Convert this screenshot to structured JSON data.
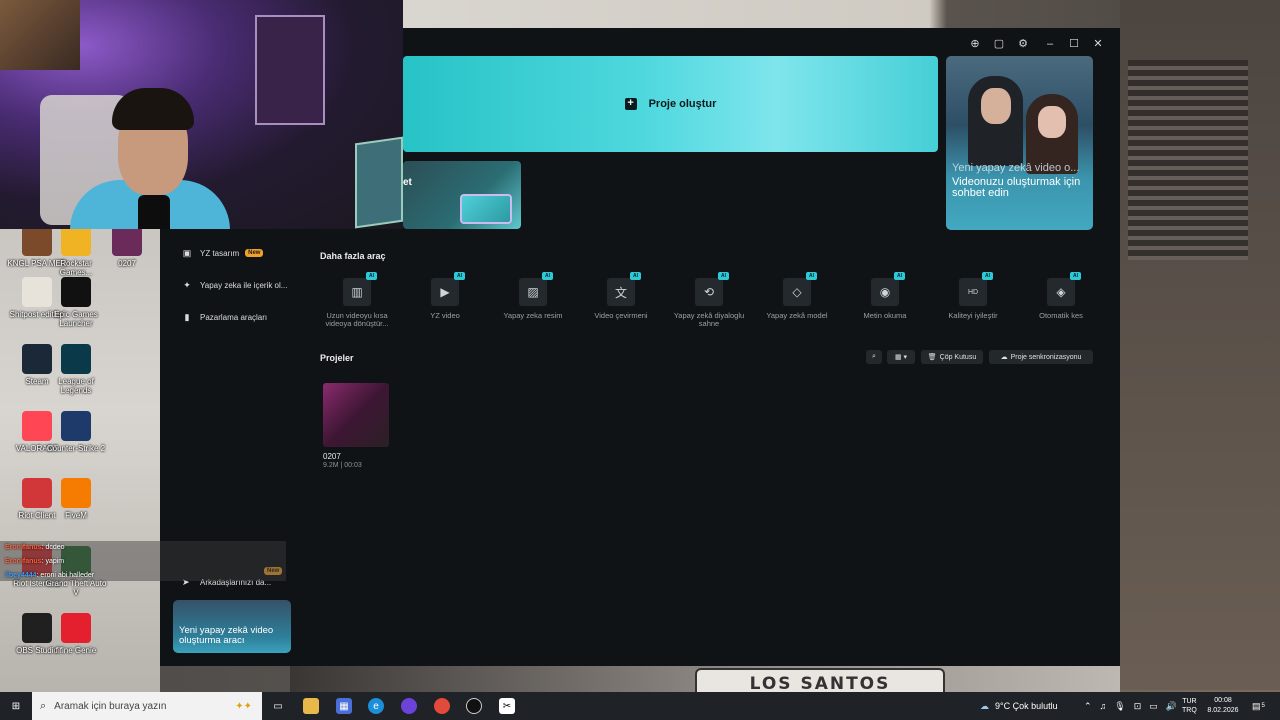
{
  "app": {
    "hero_label": "Proje oluştur",
    "subcard_text": "et",
    "promo": {
      "title": "Yeni yapay zekâ video o...",
      "description": "Videonuzu oluşturmak için sohbet edin"
    },
    "sidebar": {
      "items": [
        {
          "label": "YZ tasarım",
          "badge": "New",
          "icon": "design-icon"
        },
        {
          "label": "Yapay zeka ile içerik ol...",
          "icon": "sparkle-icon"
        },
        {
          "label": "Pazarlama araçları",
          "icon": "bag-icon"
        }
      ],
      "invite_label": "Arkadaşlarınızı da...",
      "invite_badge": "New",
      "side_promo": "Yeni yapay zekâ video oluşturma aracı"
    },
    "tools_title": "Daha fazla araç",
    "ai_badge": "AI",
    "tools": [
      {
        "label": "Uzun videoyu kısa videoya dönüştür...",
        "icon": "film-icon"
      },
      {
        "label": "YZ video",
        "icon": "video-play-icon"
      },
      {
        "label": "Yapay zeka resim",
        "icon": "image-icon"
      },
      {
        "label": "Video çevirmeni",
        "icon": "translate-icon"
      },
      {
        "label": "Yapay zekâ diyaloglu sahne",
        "icon": "dialogue-icon"
      },
      {
        "label": "Yapay zekâ model",
        "icon": "shirt-icon"
      },
      {
        "label": "Metin okuma",
        "icon": "speech-icon"
      },
      {
        "label": "Kaliteyi iyileştir",
        "icon": "hd-icon"
      },
      {
        "label": "Otomatik kes",
        "icon": "eraser-icon"
      }
    ],
    "projects_title": "Projeler",
    "trash_label": "Çöp Kutusu",
    "sync_label": "Proje senkronizasyonu",
    "projects": [
      {
        "name": "0207",
        "meta": "9.2M | 00:03"
      }
    ]
  },
  "chat": [
    {
      "user": "Eronifanus",
      "msg": ": dcdeo",
      "color": "red"
    },
    {
      "user": "Eronifanus",
      "msg": ": yapim",
      "color": "red"
    },
    {
      "user": "libey4444",
      "msg": ": eroni abi halleder",
      "color": "white"
    }
  ],
  "desktop_icons": [
    {
      "label": "KNGL PSA MEN",
      "bg": "#7a4a2a"
    },
    {
      "label": "Rockstar Games...",
      "bg": "#f0b323"
    },
    {
      "label": "0207",
      "bg": "#6a2a5a"
    },
    {
      "label": "Shitpost editleri",
      "bg": "#e7e3da"
    },
    {
      "label": "Epic Games Launcher",
      "bg": "#111111"
    },
    {
      "label": "Steam",
      "bg": "#1b2838"
    },
    {
      "label": "League of Legends",
      "bg": "#0a3a4a"
    },
    {
      "label": "VALORANT",
      "bg": "#ff4655"
    },
    {
      "label": "Counter-Strike 2",
      "bg": "#1d3a6a"
    },
    {
      "label": "Riot Client",
      "bg": "#d13639"
    },
    {
      "label": "FiveM",
      "bg": "#f57c00"
    },
    {
      "label": "Riot İstemcisi",
      "bg": "#d13639"
    },
    {
      "label": "Grand Theft Auto V",
      "bg": "#2f6e3a"
    },
    {
      "label": "OBS Studio",
      "bg": "#202020"
    },
    {
      "label": "fifine Genie",
      "bg": "#e5202e"
    }
  ],
  "taskbar": {
    "search_placeholder": "Aramak için buraya yazın",
    "weather": "9°C  Çok bulutlu",
    "lang_top": "TUR",
    "lang_bottom": "TRQ",
    "time": "00:08",
    "date": "8.02.2026",
    "notif_count": "5"
  },
  "overlay": {
    "sign_text": "LOS SANTOS"
  }
}
